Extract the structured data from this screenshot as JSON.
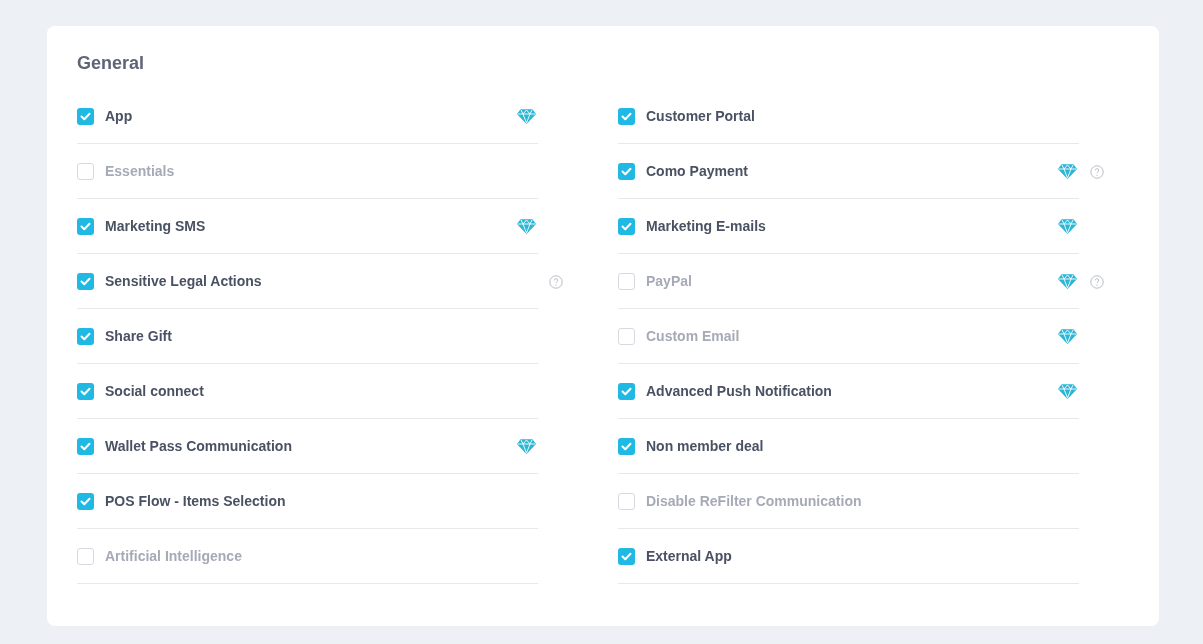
{
  "section": {
    "title": "General"
  },
  "columns": [
    {
      "items": [
        {
          "label": "App",
          "checked": true,
          "premium": true,
          "help": false
        },
        {
          "label": "Essentials",
          "checked": false,
          "premium": false,
          "help": false
        },
        {
          "label": "Marketing SMS",
          "checked": true,
          "premium": true,
          "help": false
        },
        {
          "label": "Sensitive Legal Actions",
          "checked": true,
          "premium": false,
          "help": true
        },
        {
          "label": "Share Gift",
          "checked": true,
          "premium": false,
          "help": false
        },
        {
          "label": "Social connect",
          "checked": true,
          "premium": false,
          "help": false
        },
        {
          "label": "Wallet Pass Communication",
          "checked": true,
          "premium": true,
          "help": false
        },
        {
          "label": "POS Flow - Items Selection",
          "checked": true,
          "premium": false,
          "help": false
        },
        {
          "label": "Artificial Intelligence",
          "checked": false,
          "premium": false,
          "help": false
        }
      ]
    },
    {
      "items": [
        {
          "label": "Customer Portal",
          "checked": true,
          "premium": false,
          "help": false
        },
        {
          "label": "Como Payment",
          "checked": true,
          "premium": true,
          "help": true
        },
        {
          "label": "Marketing E-mails",
          "checked": true,
          "premium": true,
          "help": false
        },
        {
          "label": "PayPal",
          "checked": false,
          "premium": true,
          "help": true
        },
        {
          "label": "Custom Email",
          "checked": false,
          "premium": true,
          "help": false
        },
        {
          "label": "Advanced Push Notification",
          "checked": true,
          "premium": true,
          "help": false
        },
        {
          "label": "Non member deal",
          "checked": true,
          "premium": false,
          "help": false
        },
        {
          "label": "Disable ReFilter Communication",
          "checked": false,
          "premium": false,
          "help": false
        },
        {
          "label": "External App",
          "checked": true,
          "premium": false,
          "help": false
        }
      ]
    }
  ]
}
